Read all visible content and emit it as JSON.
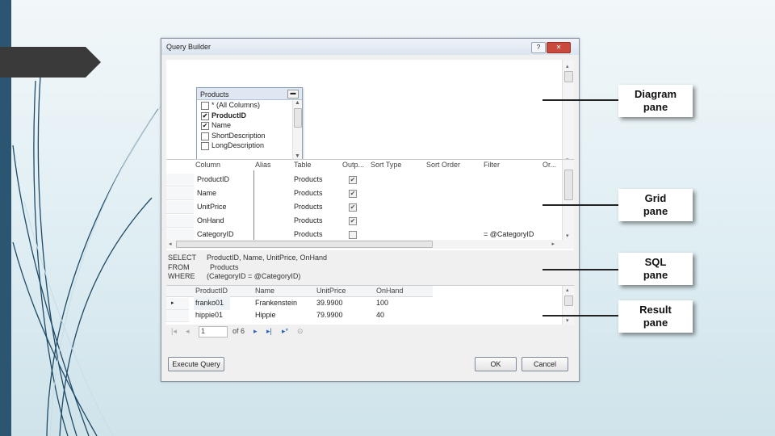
{
  "window": {
    "title": "Query Builder",
    "title_buttons": [
      "?",
      "✕"
    ]
  },
  "diagram": {
    "table_name": "Products",
    "columns": [
      {
        "label": "* (All Columns)",
        "checked": false,
        "bold": false
      },
      {
        "label": "ProductID",
        "checked": true,
        "bold": true
      },
      {
        "label": "Name",
        "checked": true,
        "bold": false
      },
      {
        "label": "ShortDescription",
        "checked": false,
        "bold": false
      },
      {
        "label": "LongDescription",
        "checked": false,
        "bold": false
      }
    ]
  },
  "grid": {
    "headers": [
      "Column",
      "Alias",
      "Table",
      "Outp...",
      "Sort Type",
      "Sort Order",
      "Filter",
      "Or..."
    ],
    "rows": [
      {
        "column": "ProductID",
        "table": "Products",
        "output": true,
        "filter": ""
      },
      {
        "column": "Name",
        "table": "Products",
        "output": true,
        "filter": ""
      },
      {
        "column": "UnitPrice",
        "table": "Products",
        "output": true,
        "filter": ""
      },
      {
        "column": "OnHand",
        "table": "Products",
        "output": true,
        "filter": ""
      },
      {
        "column": "CategoryID",
        "table": "Products",
        "output": false,
        "filter": "= @CategoryID"
      }
    ]
  },
  "sql": {
    "lines": [
      {
        "keyword": "SELECT",
        "text": "ProductID, Name, UnitPrice, OnHand"
      },
      {
        "keyword": "FROM",
        "text": "Products"
      },
      {
        "keyword": "WHERE",
        "text": "(CategoryID = @CategoryID)"
      }
    ]
  },
  "results": {
    "headers": [
      "ProductID",
      "Name",
      "UnitPrice",
      "OnHand"
    ],
    "rows": [
      [
        "franko01",
        "Frankenstein",
        "39.9900",
        "100"
      ],
      [
        "hippie01",
        "Hippie",
        "79.9900",
        "40"
      ]
    ],
    "current_record": "1",
    "record_total": "of 6"
  },
  "buttons": {
    "execute": "Execute Query",
    "ok": "OK",
    "cancel": "Cancel"
  },
  "callouts": {
    "diagram": [
      "Diagram",
      "pane"
    ],
    "grid": [
      "Grid",
      "pane"
    ],
    "sql": [
      "SQL",
      "pane"
    ],
    "result": [
      "Result",
      "pane"
    ]
  },
  "colors": {
    "slide_bar": "#2b5570",
    "accent_arrow": "#3a3a3a"
  }
}
